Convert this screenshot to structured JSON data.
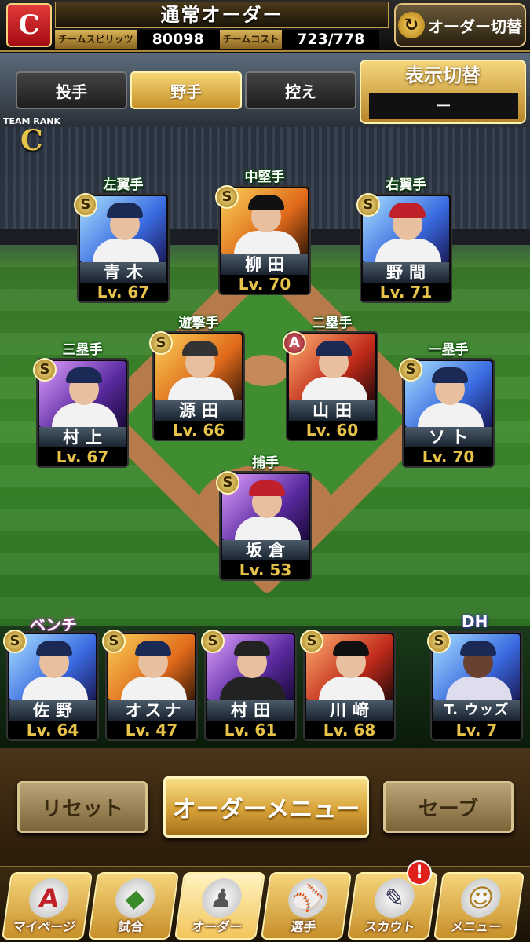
{
  "header": {
    "team_logo_letter": "C",
    "title": "通常オーダー",
    "team_spirits_label": "チームスピリッツ",
    "team_spirits_value": "80098",
    "team_cost_label": "チームコスト",
    "team_cost_value": "723/778",
    "switch_order_label": "オーダー切替",
    "switch_order_icon": "swap-icon"
  },
  "tabs": [
    {
      "label": "投手",
      "active": false
    },
    {
      "label": "野手",
      "active": true
    },
    {
      "label": "控え",
      "active": false
    }
  ],
  "display_toggle": {
    "label": "表示切替",
    "value": "ー"
  },
  "team_rank": {
    "label": "TEAM RANK",
    "value": "C"
  },
  "fielders": [
    {
      "position": "左翼手",
      "name": "青木",
      "level": "Lv. 67",
      "rarity": "S",
      "bg": "blue"
    },
    {
      "position": "中堅手",
      "name": "柳田",
      "level": "Lv. 70",
      "rarity": "S",
      "bg": "gold"
    },
    {
      "position": "右翼手",
      "name": "野間",
      "level": "Lv. 71",
      "rarity": "S",
      "bg": "blue"
    },
    {
      "position": "三塁手",
      "name": "村上",
      "level": "Lv. 67",
      "rarity": "S",
      "bg": "purple"
    },
    {
      "position": "遊撃手",
      "name": "源田",
      "level": "Lv. 66",
      "rarity": "S",
      "bg": "gold"
    },
    {
      "position": "二塁手",
      "name": "山田",
      "level": "Lv. 60",
      "rarity": "A",
      "bg": "red"
    },
    {
      "position": "一塁手",
      "name": "ソト",
      "level": "Lv. 70",
      "rarity": "S",
      "bg": "blue"
    },
    {
      "position": "捕手",
      "name": "坂倉",
      "level": "Lv. 53",
      "rarity": "S",
      "bg": "purple"
    }
  ],
  "bench": {
    "label": "ベンチ",
    "dh_label": "DH",
    "players": [
      {
        "name": "佐野",
        "level": "Lv. 64",
        "rarity": "S",
        "bg": "blue"
      },
      {
        "name": "オスナ",
        "level": "Lv. 47",
        "rarity": "S",
        "bg": "gold"
      },
      {
        "name": "村田",
        "level": "Lv. 61",
        "rarity": "S",
        "bg": "purple"
      },
      {
        "name": "川﨑",
        "level": "Lv. 68",
        "rarity": "S",
        "bg": "red"
      },
      {
        "name": "T. ウッズ",
        "level": "Lv. 7",
        "rarity": "S",
        "bg": "blue"
      }
    ]
  },
  "actions": {
    "reset": "リセット",
    "order_menu": "オーダーメニュー",
    "save": "セーブ"
  },
  "nav": [
    {
      "label": "マイページ",
      "icon": "A"
    },
    {
      "label": "試合",
      "icon": "◆"
    },
    {
      "label": "オーダー",
      "icon": "♟"
    },
    {
      "label": "選手",
      "icon": "⚾"
    },
    {
      "label": "スカウト",
      "icon": "✎"
    },
    {
      "label": "メニュー",
      "icon": "☺"
    }
  ],
  "notification_badge": "!",
  "colors": {
    "accent_gold": "#e8c34a",
    "brand_red": "#c0202a"
  }
}
